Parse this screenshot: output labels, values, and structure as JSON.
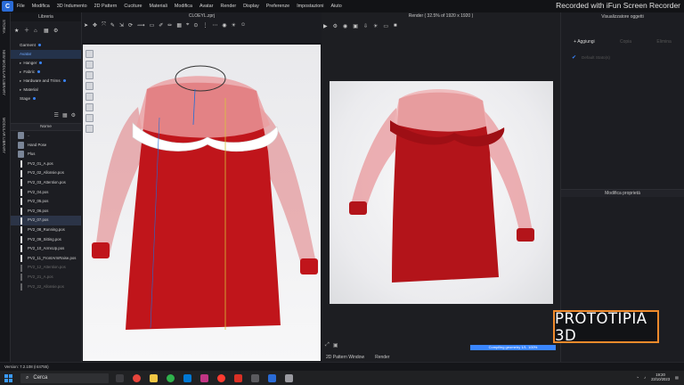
{
  "menubar": {
    "logo": "C",
    "items": [
      "File",
      "Modifica",
      "3D Indumento",
      "2D Pattern",
      "Cuciture",
      "Materiali",
      "Modifica",
      "Avatar",
      "Render",
      "Display",
      "Preferenze",
      "Impostazioni",
      "Aiuto"
    ]
  },
  "watermark": "Recorded with iFun Screen Recorder",
  "rail": {
    "tab1": "STORIA",
    "tab2": "NEW MODULAR LIBRARY",
    "tab3": "MODULAR LIBRARY"
  },
  "library": {
    "title": "Libreria",
    "tree": [
      {
        "label": "Garment",
        "dot": true
      },
      {
        "label": "Avatar",
        "selected": true
      },
      {
        "label": "Hanger",
        "dot": true
      },
      {
        "label": "Fabric",
        "dot": true
      },
      {
        "label": "Hardware and Trims",
        "dot": true
      },
      {
        "label": "Material"
      },
      {
        "label": "Stage",
        "dot": true
      }
    ],
    "file_column": "Nome",
    "files": [
      {
        "name": "..",
        "type": "folder"
      },
      {
        "name": "Hand Pose",
        "type": "folder"
      },
      {
        "name": "Plus",
        "type": "folder"
      },
      {
        "name": "PV2_01_A.pos",
        "type": "pose"
      },
      {
        "name": "PV2_02_Allonsie.pos",
        "type": "pose"
      },
      {
        "name": "PV2_03_Attention.pos",
        "type": "pose"
      },
      {
        "name": "PV2_04.pos",
        "type": "pose"
      },
      {
        "name": "PV2_05.pos",
        "type": "pose"
      },
      {
        "name": "PV2_06.pos",
        "type": "pose"
      },
      {
        "name": "PV2_07.pos",
        "type": "pose",
        "selected": true
      },
      {
        "name": "PV2_08_Running.pos",
        "type": "pose"
      },
      {
        "name": "PV2_09_Sitting.pos",
        "type": "pose"
      },
      {
        "name": "PV2_10_ArmsUp.pos",
        "type": "pose"
      },
      {
        "name": "PV2_11_FrontArmRaise.pos",
        "type": "pose"
      },
      {
        "name": "PV2_12_Attention.pos",
        "type": "pose",
        "faded": true
      },
      {
        "name": "PV2_21_A.pos",
        "type": "pose",
        "faded": true
      },
      {
        "name": "PV2_22_Allonsie.pos",
        "type": "pose",
        "faded": true
      }
    ]
  },
  "viewport3d": {
    "title": "CLOEYL.zprj"
  },
  "render": {
    "title": "Render ( 32.5% of 1920 x 1920 )",
    "progress_text": "Compiling geometry 1/1. 100%",
    "progress_value": 1.0,
    "tabs": [
      "2D Pattern Window",
      "Render"
    ]
  },
  "right_panel": {
    "title": "Visualizzatore oggetti",
    "add_label": "+ Aggiungi",
    "copy_label": "Copia",
    "delete_label": "Elimina",
    "object_name": "Default Stato(s)",
    "properties_title": "Modifica proprietà"
  },
  "brand": "PROTOTIPIA 3D",
  "status": "Version: 7.2.108 (r44755)",
  "taskbar": {
    "search_placeholder": "Cerca",
    "time": "19:20",
    "date": "23/10/2023"
  },
  "colors": {
    "accent": "#3a86ff",
    "brand_border": "#f08a2b",
    "dress_red": "#c0151b"
  }
}
